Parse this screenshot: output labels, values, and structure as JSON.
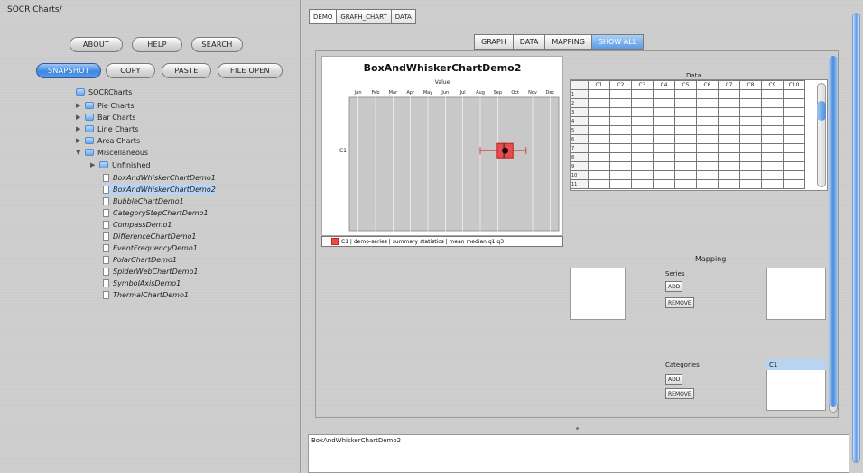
{
  "app": {
    "title": "SOCR Charts/"
  },
  "toolbar": {
    "row1": [
      "ABOUT",
      "HELP",
      "SEARCH"
    ],
    "row2": [
      "SNAPSHOT",
      "COPY",
      "PASTE",
      "FILE OPEN"
    ],
    "active": "SNAPSHOT"
  },
  "tree": {
    "root": "SOCRCharts",
    "folders": [
      "Pie Charts",
      "Bar Charts",
      "Line Charts",
      "Area Charts",
      "Miscellaneous"
    ],
    "subfolder": "Unfinished",
    "items": [
      "BoxAndWhiskerChartDemo1",
      "BoxAndWhiskerChartDemo2",
      "BubbleChartDemo1",
      "CategoryStepChartDemo1",
      "CompassDemo1",
      "DifferenceChartDemo1",
      "EventFrequencyDemo1",
      "PolarChartDemo1",
      "SpiderWebChartDemo1",
      "SymbolAxisDemo1",
      "ThermalChartDemo1"
    ],
    "selected": "BoxAndWhiskerChartDemo2"
  },
  "top_tabs": [
    "DEMO",
    "GRAPH_CHART",
    "DATA"
  ],
  "view_tabs": [
    "GRAPH",
    "DATA",
    "MAPPING",
    "SHOW ALL"
  ],
  "active_view_tab": "SHOW ALL",
  "chart_data": {
    "type": "box",
    "title": "BoxAndWhiskerChartDemo2",
    "xlabel": "Value",
    "categories": [
      "Jan",
      "Feb",
      "Mar",
      "Apr",
      "May",
      "Jun",
      "Jul",
      "Aug",
      "Sep",
      "Oct",
      "Nov",
      "Dec"
    ],
    "ylabel_category": "C1",
    "series": [
      {
        "name": "C1",
        "min": 10,
        "q1": 11.3,
        "median": 11.8,
        "q3": 12.5,
        "max": 13.5,
        "mean": 11.9
      }
    ],
    "colors": {
      "box": "#e84c4c",
      "plot_bg": "#c8c8c8",
      "grid": "#ffffff"
    },
    "legend": "C1 | demo-series | summary statistics | mean median q1 q3"
  },
  "data_panel": {
    "title": "Data",
    "columns": [
      "C1",
      "C2",
      "C3",
      "C4",
      "C5",
      "C6",
      "C7",
      "C8",
      "C9",
      "C10"
    ],
    "row_headers": [
      "1",
      "2",
      "3",
      "4",
      "5",
      "6",
      "7",
      "8",
      "9",
      "10",
      "11"
    ]
  },
  "mapping": {
    "title": "Mapping",
    "series_label": "Series",
    "categories_label": "Categories",
    "add": "ADD",
    "remove": "REMOVE",
    "category_selected": "C1"
  },
  "log": {
    "text": "BoxAndWhiskerChartDemo2"
  }
}
